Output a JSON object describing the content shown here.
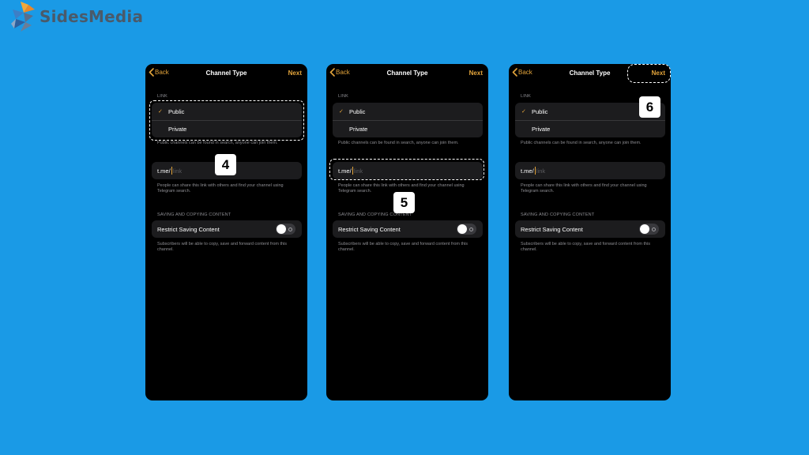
{
  "brand": {
    "name": "SidesMedia",
    "text_color": "#4a5a6a"
  },
  "colors": {
    "background": "#1a9ae6",
    "accent": "#e3a43b",
    "cell": "#1c1c1e",
    "secondary_text": "#8e8e93"
  },
  "screens": [
    {
      "nav": {
        "back_label": "Back",
        "title": "Channel Type",
        "next_label": "Next"
      },
      "link_section": "LINK",
      "options": [
        {
          "label": "Public",
          "selected": true
        },
        {
          "label": "Private",
          "selected": false
        }
      ],
      "public_note": "Public channels can be found in search, anyone can join them.",
      "link_prefix": "t.me/",
      "link_placeholder": "link",
      "link_note": "People can share this link with others and find your channel using Telegram search.",
      "saving_section": "SAVING AND COPYING CONTENT",
      "restrict_label": "Restrict Saving Content",
      "restrict_enabled": false,
      "restrict_note": "Subscribers will be able to copy, save and forward content from this channel.",
      "step": "4"
    },
    {
      "nav": {
        "back_label": "Back",
        "title": "Channel Type",
        "next_label": "Next"
      },
      "link_section": "LINK",
      "options": [
        {
          "label": "Public",
          "selected": true
        },
        {
          "label": "Private",
          "selected": false
        }
      ],
      "public_note": "Public channels can be found in search, anyone can join them.",
      "link_prefix": "t.me/",
      "link_placeholder": "link",
      "link_note": "People can share this link with others and find your channel using Telegram search.",
      "saving_section": "SAVING AND COPYING CONTENT",
      "restrict_label": "Restrict Saving Content",
      "restrict_enabled": false,
      "restrict_note": "Subscribers will be able to copy, save and forward content from this channel.",
      "step": "5"
    },
    {
      "nav": {
        "back_label": "Back",
        "title": "Channel Type",
        "next_label": "Next"
      },
      "link_section": "LINK",
      "options": [
        {
          "label": "Public",
          "selected": true
        },
        {
          "label": "Private",
          "selected": false
        }
      ],
      "public_note": "Public channels can be found in search, anyone can join them.",
      "link_prefix": "t.me/",
      "link_placeholder": "link",
      "link_note": "People can share this link with others and find your channel using Telegram search.",
      "saving_section": "SAVING AND COPYING CONTENT",
      "restrict_label": "Restrict Saving Content",
      "restrict_enabled": false,
      "restrict_note": "Subscribers will be able to copy, save and forward content from this channel.",
      "step": "6"
    }
  ]
}
